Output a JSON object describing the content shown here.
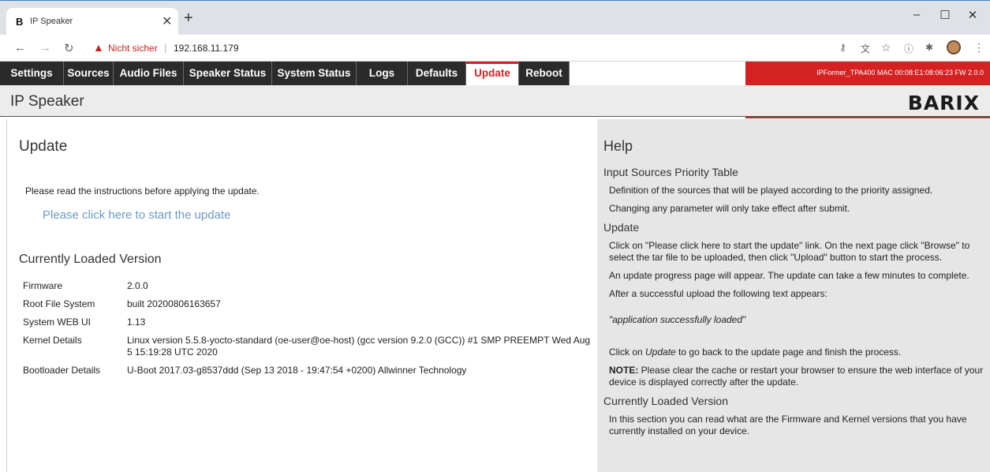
{
  "browser": {
    "tab_title": "IP Speaker",
    "tab_favicon": "B",
    "security_label": "Nicht sicher",
    "url": "192.168.11.179",
    "icons": [
      "back-icon",
      "forward-icon",
      "reload-icon",
      "warning-icon",
      "key-icon",
      "translate-icon",
      "star-icon",
      "info-icon",
      "extensions-icon",
      "profile-avatar",
      "menu-icon"
    ]
  },
  "nav": {
    "tabs": [
      "Settings",
      "Sources",
      "Audio Files",
      "Speaker Status",
      "System Status",
      "Logs",
      "Defaults",
      "Update",
      "Reboot"
    ],
    "active": "Update",
    "device_info": "IPFormer_TPA400  MAC 00:08:E1:08:06:23  FW 2.0.0"
  },
  "header": {
    "title": "IP Speaker",
    "logo": "BARIX"
  },
  "main": {
    "title": "Update",
    "intro": "Please read the instructions before applying the update.",
    "update_link": "Please click here to start the update",
    "version_title": "Currently Loaded Version",
    "versions": [
      {
        "label": "Firmware",
        "value": "2.0.0"
      },
      {
        "label": "Root File System",
        "value": "built 20200806163657"
      },
      {
        "label": "System WEB UI",
        "value": "1.13"
      },
      {
        "label": "Kernel Details",
        "value": "Linux version 5.5.8-yocto-standard (oe-user@oe-host) (gcc version 9.2.0 (GCC)) #1 SMP PREEMPT Wed Aug 5 15:19:28 UTC 2020"
      },
      {
        "label": "Bootloader Details",
        "value": "U-Boot 2017.03-g8537ddd (Sep 13 2018 - 19:47:54 +0200) Allwinner Technology"
      }
    ]
  },
  "help": {
    "title": "Help",
    "priority_heading": "Input Sources Priority Table",
    "priority_p1": "Definition of the sources that will be played according to the priority assigned.",
    "priority_p2": "Changing any parameter will only take effect after submit.",
    "update_heading": "Update",
    "update_p1": "Click on \"Please click here to start the update\" link. On the next page click \"Browse\" to select the tar file to be uploaded, then click \"Upload\" button to start the process.",
    "update_p2": "An update progress page will appear. The update can take a few minutes to complete.",
    "update_p3": "After a successful upload the following text appears:",
    "success_text": "\"application successfully loaded\"",
    "update_p4_pre": "Click on ",
    "update_p4_link": "Update",
    "update_p4_post": " to go back to the update page and finish the process.",
    "note_label": "NOTE:",
    "note_text": " Please clear the cache or restart your browser to ensure the web interface of your device is displayed correctly after the update.",
    "version_heading": "Currently Loaded Version",
    "version_p": "In this section you can read what are the Firmware and Kernel versions that you have currently installed on your device."
  }
}
